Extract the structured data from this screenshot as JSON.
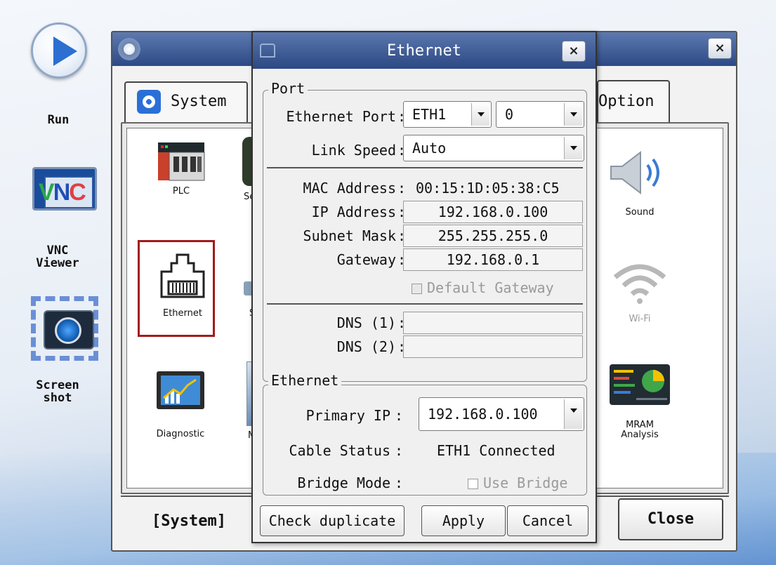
{
  "launcher": {
    "run_label": "Run",
    "vnc_label_line1": "VNC",
    "vnc_label_line2": "Viewer",
    "vnc_icon_text": "VNC",
    "screenshot_label_line1": "Screen",
    "screenshot_label_line2": "shot"
  },
  "system_window": {
    "tab_system": "System",
    "tab_option": "Option",
    "items": [
      {
        "label": "PLC"
      },
      {
        "label": "Ethernet"
      },
      {
        "label": "Diagnostic"
      },
      {
        "label": "Sound"
      },
      {
        "label": "Wi-Fi"
      },
      {
        "label": "MRAM\nAnalysis"
      }
    ],
    "partial_letters": [
      "Se",
      "S",
      "M"
    ],
    "footer_label": "[System]",
    "close_label": "Close",
    "close_x": "×"
  },
  "dialog": {
    "title": "Ethernet",
    "close_x": "×",
    "port_group": "Port",
    "ethernet_port_label": "Ethernet Port",
    "ethernet_port_value": "ETH1",
    "ethernet_port_index": "0",
    "link_speed_label": "Link Speed",
    "link_speed_value": "Auto",
    "mac_label": "MAC Address",
    "mac_value": "00:15:1D:05:38:C5",
    "ip_label": "IP Address",
    "ip_value": "192.168.0.100",
    "subnet_label": "Subnet Mask",
    "subnet_value": "255.255.255.0",
    "gateway_label": "Gateway",
    "gateway_value": "192.168.0.1",
    "default_gateway_label": "Default Gateway",
    "dns1_label": "DNS (1)",
    "dns1_value": "",
    "dns2_label": "DNS (2)",
    "dns2_value": "",
    "ethernet_group": "Ethernet",
    "primary_ip_label": "Primary IP",
    "primary_ip_value": "192.168.0.100",
    "cable_status_label": "Cable Status",
    "cable_status_value": "ETH1 Connected",
    "bridge_mode_label": "Bridge Mode",
    "use_bridge_label": "Use Bridge",
    "check_duplicate": "Check duplicate",
    "apply": "Apply",
    "cancel": "Cancel",
    "colon": ":"
  }
}
